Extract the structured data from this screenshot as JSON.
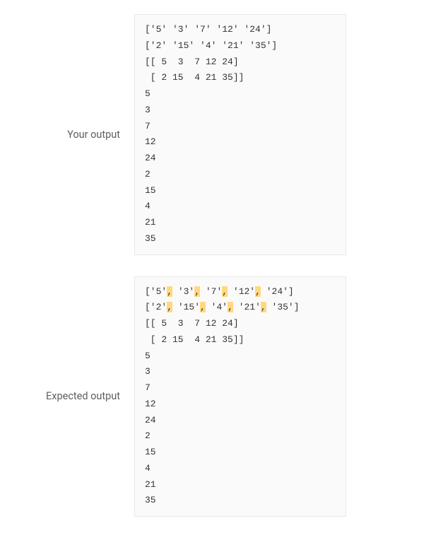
{
  "your_output": {
    "label": "Your output",
    "lines": [
      "['5' '3' '7' '12' '24']",
      "['2' '15' '4' '21' '35']",
      "[[ 5  3  7 12 24]",
      " [ 2 15  4 21 35]]",
      "5",
      "3",
      "7",
      "12",
      "24",
      "2",
      "15",
      "4",
      "21",
      "35"
    ]
  },
  "expected_output": {
    "label": "Expected output",
    "lines_with_highlights": [
      {
        "segments": [
          {
            "text": "['5'",
            "hl": false
          },
          {
            "text": ",",
            "hl": true
          },
          {
            "text": " '3'",
            "hl": false
          },
          {
            "text": ",",
            "hl": true
          },
          {
            "text": " '7'",
            "hl": false
          },
          {
            "text": ",",
            "hl": true
          },
          {
            "text": " '12'",
            "hl": false
          },
          {
            "text": ",",
            "hl": true
          },
          {
            "text": " '24']",
            "hl": false
          }
        ]
      },
      {
        "segments": [
          {
            "text": "['2'",
            "hl": false
          },
          {
            "text": ",",
            "hl": true
          },
          {
            "text": " '15'",
            "hl": false
          },
          {
            "text": ",",
            "hl": true
          },
          {
            "text": " '4'",
            "hl": false
          },
          {
            "text": ",",
            "hl": true
          },
          {
            "text": " '21'",
            "hl": false
          },
          {
            "text": ",",
            "hl": true
          },
          {
            "text": " '35']",
            "hl": false
          }
        ]
      },
      {
        "segments": [
          {
            "text": "[[ 5  3  7 12 24]",
            "hl": false
          }
        ]
      },
      {
        "segments": [
          {
            "text": " [ 2 15  4 21 35]]",
            "hl": false
          }
        ]
      },
      {
        "segments": [
          {
            "text": "5",
            "hl": false
          }
        ]
      },
      {
        "segments": [
          {
            "text": "3",
            "hl": false
          }
        ]
      },
      {
        "segments": [
          {
            "text": "7",
            "hl": false
          }
        ]
      },
      {
        "segments": [
          {
            "text": "12",
            "hl": false
          }
        ]
      },
      {
        "segments": [
          {
            "text": "24",
            "hl": false
          }
        ]
      },
      {
        "segments": [
          {
            "text": "2",
            "hl": false
          }
        ]
      },
      {
        "segments": [
          {
            "text": "15",
            "hl": false
          }
        ]
      },
      {
        "segments": [
          {
            "text": "4",
            "hl": false
          }
        ]
      },
      {
        "segments": [
          {
            "text": "21",
            "hl": false
          }
        ]
      },
      {
        "segments": [
          {
            "text": "35",
            "hl": false
          }
        ]
      }
    ]
  }
}
